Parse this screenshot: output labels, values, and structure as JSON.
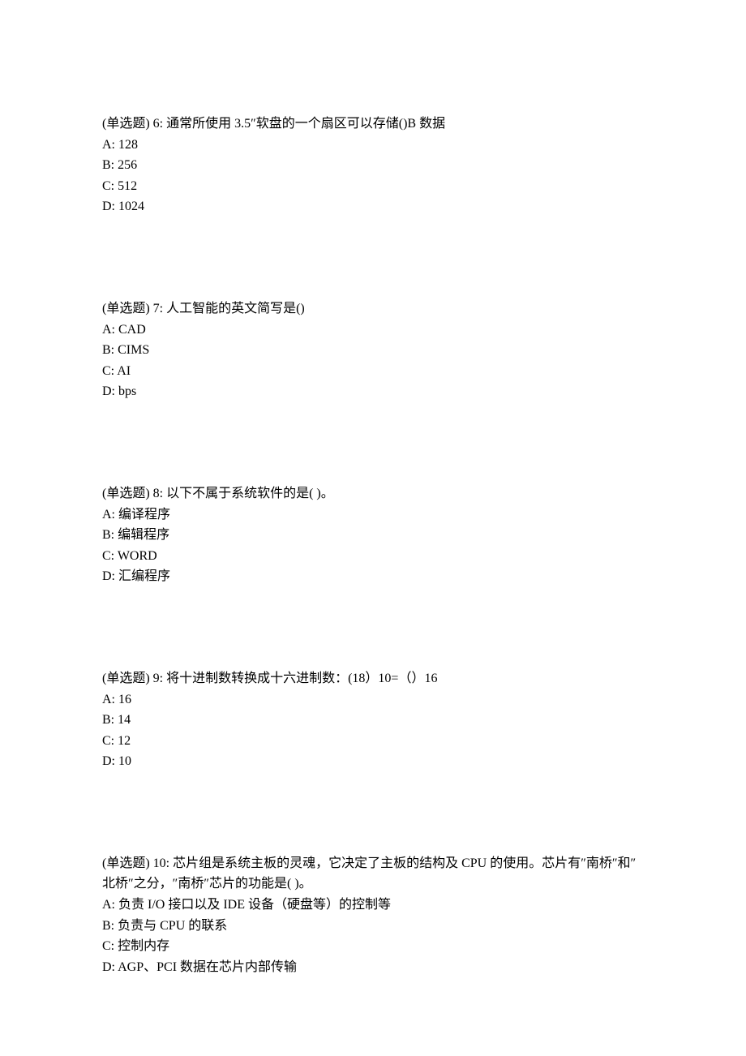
{
  "questions": [
    {
      "prompt": "(单选题) 6: 通常所使用 3.5″软盘的一个扇区可以存储()B 数据",
      "options": {
        "A": "A: 128",
        "B": "B: 256",
        "C": "C: 512",
        "D": "D: 1024"
      }
    },
    {
      "prompt": "(单选题) 7: 人工智能的英文简写是()",
      "options": {
        "A": "A: CAD",
        "B": "B: CIMS",
        "C": "C: AI",
        "D": "D: bps"
      }
    },
    {
      "prompt": "(单选题) 8: 以下不属于系统软件的是( )。",
      "options": {
        "A": "A: 编译程序",
        "B": "B: 编辑程序",
        "C": "C: WORD",
        "D": "D: 汇编程序"
      }
    },
    {
      "prompt": "(单选题) 9: 将十进制数转换成十六进制数：(18）10=（）16",
      "options": {
        "A": "A: 16",
        "B": "B: 14",
        "C": "C: 12",
        "D": "D: 10"
      }
    },
    {
      "prompt": "(单选题) 10: 芯片组是系统主板的灵魂，它决定了主板的结构及 CPU 的使用。芯片有″南桥″和″北桥″之分，″南桥″芯片的功能是( )。",
      "options": {
        "A": "A: 负责 I/O 接口以及 IDE 设备（硬盘等）的控制等",
        "B": "B: 负责与 CPU 的联系",
        "C": "C: 控制内存",
        "D": "D: AGP、PCI 数据在芯片内部传输"
      }
    }
  ]
}
